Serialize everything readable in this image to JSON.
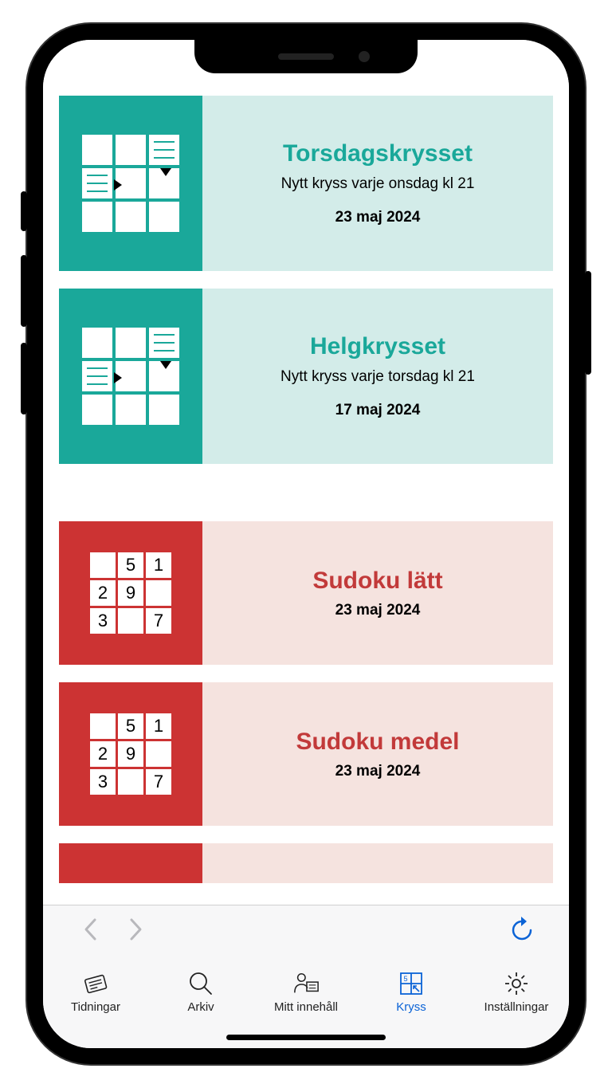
{
  "cards": [
    {
      "title": "Torsdagskrysset",
      "subtitle": "Nytt kryss varje onsdag kl 21",
      "date": "23 maj 2024",
      "theme": "teal",
      "icon": "crossword"
    },
    {
      "title": "Helgkrysset",
      "subtitle": "Nytt kryss varje torsdag kl 21",
      "date": "17 maj 2024",
      "theme": "teal",
      "icon": "crossword"
    },
    {
      "title": "Sudoku lätt",
      "subtitle": "",
      "date": "23 maj 2024",
      "theme": "red",
      "icon": "sudoku"
    },
    {
      "title": "Sudoku medel",
      "subtitle": "",
      "date": "23 maj 2024",
      "theme": "red",
      "icon": "sudoku"
    }
  ],
  "sudoku_cells": [
    "",
    "5",
    "1",
    "2",
    "9",
    "",
    "3",
    "",
    "7"
  ],
  "tabs": [
    {
      "label": "Tidningar",
      "icon": "newspaper",
      "active": false
    },
    {
      "label": "Arkiv",
      "icon": "search",
      "active": false
    },
    {
      "label": "Mitt innehåll",
      "icon": "profile",
      "active": false
    },
    {
      "label": "Kryss",
      "icon": "grid",
      "active": true
    },
    {
      "label": "Inställningar",
      "icon": "gear",
      "active": false
    }
  ]
}
